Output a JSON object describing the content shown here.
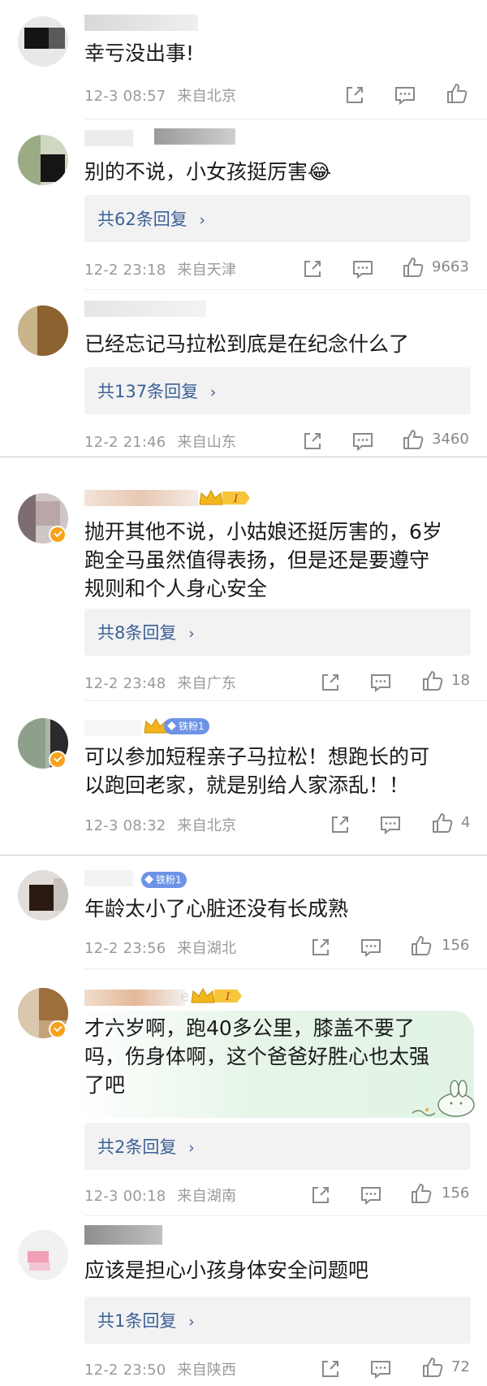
{
  "comments": [
    {
      "text": "幸亏没出事!",
      "time": "12-3 08:57",
      "location": "来自北京",
      "likes": ""
    },
    {
      "text": "别的不说，小女孩挺厉害😂",
      "replies": "共62条回复",
      "time": "12-2 23:18",
      "location": "来自天津",
      "likes": "9663"
    },
    {
      "text": "已经忘记马拉松到底是在纪念什么了",
      "replies": "共137条回复",
      "time": "12-2 21:46",
      "location": "来自山东",
      "likes": "3460"
    },
    {
      "text_lines": [
        "抛开其他不说，小姑娘还挺厉害的，6岁",
        "跑全马虽然值得表扬，但是还是要遵守",
        "规则和个人身心安全"
      ],
      "badge": "I",
      "replies": "共8条回复",
      "time": "12-2 23:48",
      "location": "来自广东",
      "likes": "18"
    },
    {
      "text_lines": [
        "可以参加短程亲子马拉松！想跑长的可",
        "以跑回老家，就是别给人家添乱！！"
      ],
      "fan_badge": "铁粉1",
      "time": "12-3 08:32",
      "location": "来自北京",
      "likes": "4"
    },
    {
      "text": "年龄太小了心脏还没有长成熟",
      "fan_badge": "铁粉1",
      "time": "12-2 23:56",
      "location": "来自湖北",
      "likes": "156"
    },
    {
      "text_lines": [
        "才六岁啊，跑40多公里，膝盖不要了",
        "吗，伤身体啊，这个爸爸好胜心也太强",
        "了吧"
      ],
      "badge": "I",
      "replies": "共2条回复",
      "time": "12-3 00:18",
      "location": "来自湖南",
      "likes": "156"
    },
    {
      "text": "应该是担心小孩身体安全问题吧",
      "replies": "共1条回复",
      "time": "12-2 23:50",
      "location": "来自陕西",
      "likes": "72"
    }
  ],
  "colors": {
    "link": "#3c5f96",
    "meta": "#9a9a9a",
    "reply_bg": "#f2f2f2",
    "badge_gold": "#f7a21a",
    "fan_badge": "#6d93e6"
  },
  "icons": {
    "share": "share-icon",
    "comment": "comment-icon",
    "like": "thumbs-up-icon",
    "reply_chevron": "chevron-right-icon"
  }
}
